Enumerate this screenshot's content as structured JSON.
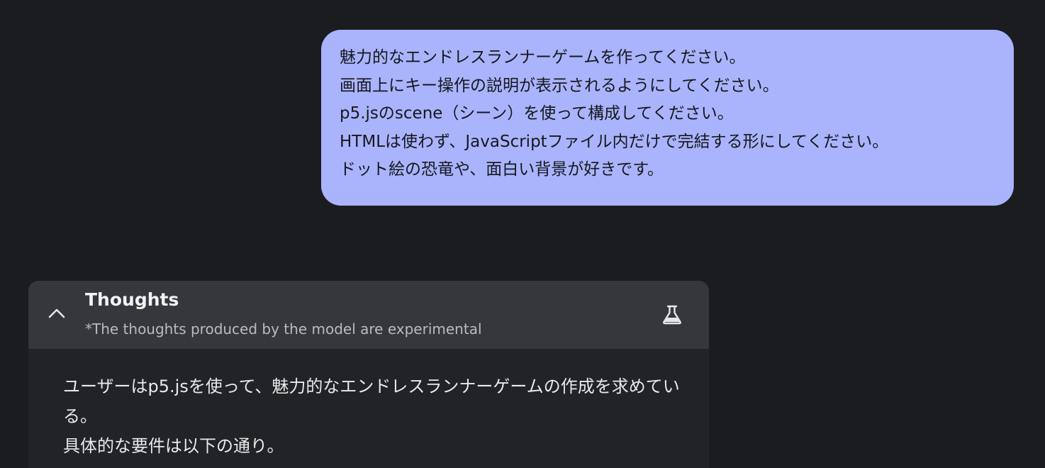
{
  "user_message": {
    "lines": [
      "魅力的なエンドレスランナーゲームを作ってください。",
      "画面上にキー操作の説明が表示されるようにしてください。",
      "p5.jsのscene（シーン）を使って構成してください。",
      "HTMLは使わず、JavaScriptファイル内だけで完結する形にしてください。",
      "ドット絵の恐竜や、面白い背景が好きです。"
    ]
  },
  "thoughts": {
    "title": "Thoughts",
    "subtitle": "*The thoughts produced by the model are experimental",
    "toggle_icon": "chevron-up-icon",
    "badge_icon": "flask-icon",
    "body": [
      "ユーザーはp5.jsを使って、魅力的なエンドレスランナーゲームの作成を求めている。",
      "具体的な要件は以下の通り。"
    ]
  },
  "colors": {
    "background": "#1b1c1f",
    "user_bubble": "#aab4fc",
    "thoughts_header": "#36373b",
    "thoughts_body": "#212326"
  }
}
